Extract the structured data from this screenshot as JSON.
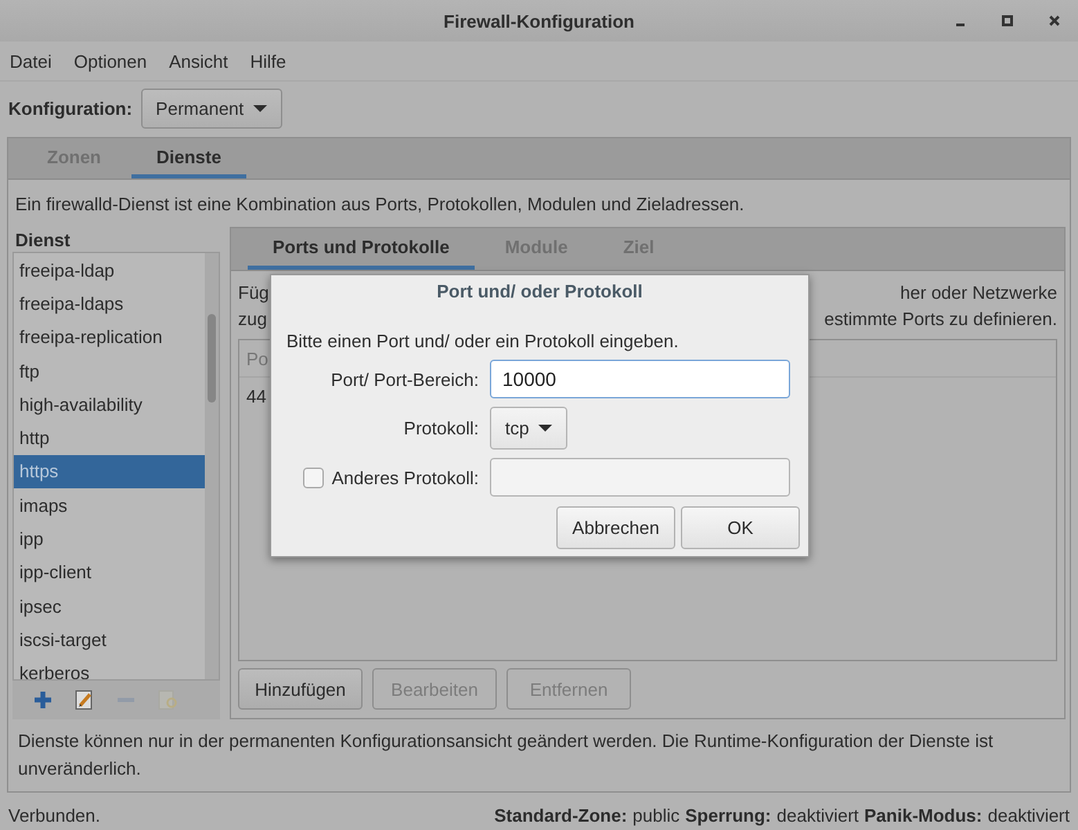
{
  "window": {
    "title": "Firewall-Konfiguration"
  },
  "menu": [
    "Datei",
    "Optionen",
    "Ansicht",
    "Hilfe"
  ],
  "configuration": {
    "label": "Konfiguration:",
    "value": "Permanent"
  },
  "tabs": [
    {
      "label": "Zonen",
      "selected": false
    },
    {
      "label": "Dienste",
      "selected": true
    }
  ],
  "description": "Ein firewalld-Dienst ist eine Kombination aus Ports, Protokollen, Modulen und Zieladressen.",
  "services": {
    "heading": "Dienst",
    "items": [
      {
        "label": "freeipa-ldap",
        "selected": false
      },
      {
        "label": "freeipa-ldaps",
        "selected": false
      },
      {
        "label": "freeipa-replication",
        "selected": false
      },
      {
        "label": "ftp",
        "selected": false
      },
      {
        "label": "high-availability",
        "selected": false
      },
      {
        "label": "http",
        "selected": false
      },
      {
        "label": "https",
        "selected": true
      },
      {
        "label": "imaps",
        "selected": false
      },
      {
        "label": "ipp",
        "selected": false
      },
      {
        "label": "ipp-client",
        "selected": false
      },
      {
        "label": "ipsec",
        "selected": false
      },
      {
        "label": "iscsi-target",
        "selected": false
      },
      {
        "label": "kerberos",
        "selected": false
      }
    ]
  },
  "service_tools": [
    {
      "kind": "add",
      "disabled": false
    },
    {
      "kind": "edit",
      "disabled": false
    },
    {
      "kind": "remove",
      "disabled": true
    },
    {
      "kind": "load",
      "disabled": true
    }
  ],
  "service_tabs": [
    {
      "label": "Ports und Protokolle",
      "selected": true
    },
    {
      "label": "Module",
      "selected": false
    },
    {
      "label": "Ziel",
      "selected": false
    }
  ],
  "service_description": [
    {
      "start": "Füg",
      "end": "her oder Netzwerke"
    },
    {
      "start": "zug",
      "end": "estimmte Ports zu definieren."
    }
  ],
  "ports_table": {
    "column_1": "Po",
    "rows": [
      "44"
    ]
  },
  "buttons": [
    {
      "label": "Hinzufügen",
      "disabled": false
    },
    {
      "label": "Bearbeiten",
      "disabled": true
    },
    {
      "label": "Entfernen",
      "disabled": true
    }
  ],
  "note": "Dienste können nur in der permanenten Konfigurationsansicht geändert werden. Die Runtime-Konfiguration der Dienste ist unveränderlich.",
  "status_bar": {
    "connection": "Verbunden.",
    "fields": [
      {
        "label": "Standard-Zone:",
        "value": "public"
      },
      {
        "label": "Sperrung:",
        "value": "deaktiviert"
      },
      {
        "label": "Panik-Modus:",
        "value": "deaktiviert"
      }
    ]
  },
  "dialog": {
    "title": "Port und/ oder Protokoll",
    "prompt": "Bitte einen Port und/ oder ein Protokoll eingeben.",
    "port_label": "Port/ Port-Bereich:",
    "port_value": "10000",
    "protocol_label": "Protokoll:",
    "protocol_value": "tcp",
    "other_protocol": {
      "label": "Anderes Protokoll:",
      "checked": false
    },
    "buttons": [
      "Abbrechen",
      "OK"
    ]
  }
}
